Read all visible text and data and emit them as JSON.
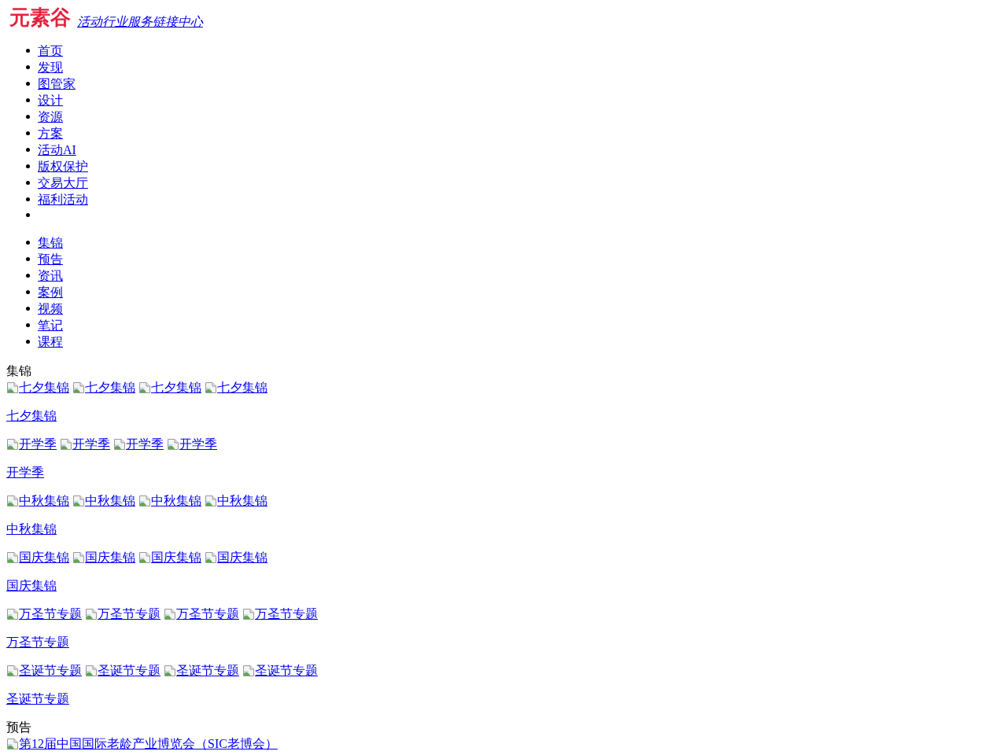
{
  "header": {
    "logo": "元素谷",
    "tagline": "活动行业服务链接中心"
  },
  "main_nav": [
    {
      "kind": "link",
      "label": "首页"
    },
    {
      "kind": "link",
      "label": "发现"
    },
    {
      "kind": "link",
      "label": "图管家"
    },
    {
      "kind": "link",
      "label": "设计"
    },
    {
      "kind": "link",
      "label": "资源"
    },
    {
      "kind": "link",
      "label": "方案"
    },
    {
      "kind": "link",
      "label": "活动AI"
    },
    {
      "kind": "link",
      "label": "版权保护"
    },
    {
      "kind": "link",
      "label": "交易大厅"
    },
    {
      "kind": "link",
      "label": "福利活动"
    },
    {
      "kind": "empty"
    }
  ],
  "section_nav": [
    "集锦",
    "预告",
    "资讯",
    "案例",
    "视频",
    "笔记",
    "课程"
  ],
  "sections": [
    {
      "title": "集锦",
      "collections": [
        {
          "images": [
            "七夕集锦",
            "七夕集锦",
            "七夕集锦",
            "七夕集锦"
          ],
          "title": "七夕集锦"
        },
        {
          "images": [
            "开学季",
            "开学季",
            "开学季",
            "开学季"
          ],
          "title": "开学季"
        },
        {
          "images": [
            "中秋集锦",
            "中秋集锦",
            "中秋集锦",
            "中秋集锦"
          ],
          "title": "中秋集锦"
        },
        {
          "images": [
            "国庆集锦",
            "国庆集锦",
            "国庆集锦",
            "国庆集锦"
          ],
          "title": "国庆集锦"
        },
        {
          "images": [
            "万圣节专题",
            "万圣节专题",
            "万圣节专题",
            "万圣节专题"
          ],
          "title": "万圣节专题"
        },
        {
          "images": [
            "圣诞节专题",
            "圣诞节专题",
            "圣诞节专题",
            "圣诞节专题"
          ],
          "title": "圣诞节专题"
        }
      ]
    },
    {
      "title": "预告",
      "collections": [
        {
          "images": [
            "第12届中国国际老龄产业博览会（SIC老博会）"
          ]
        }
      ]
    }
  ]
}
